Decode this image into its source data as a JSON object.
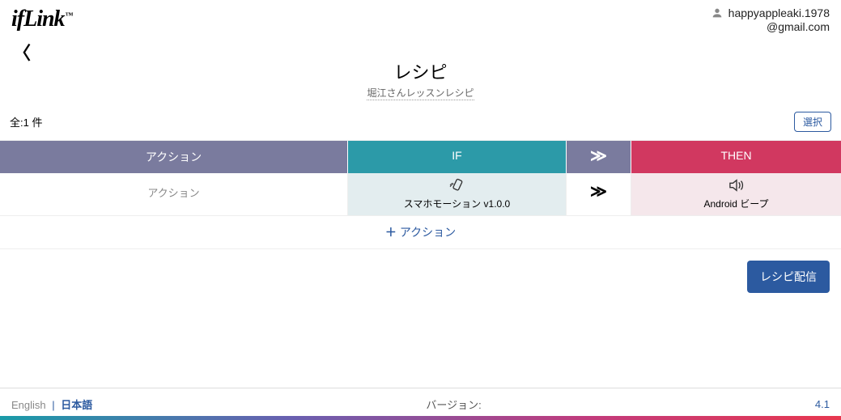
{
  "logo": {
    "text": "ifLink",
    "tm": "™"
  },
  "user": {
    "name": "happyappleaki.1978",
    "domain": "@gmail.com"
  },
  "page": {
    "title": "レシピ",
    "subtitle": "堀江さんレッスンレシピ"
  },
  "count": {
    "prefix": "全:1 件"
  },
  "buttons": {
    "select": "選択",
    "add_action": "アクション",
    "add_plus": "＋",
    "distribute": "レシピ配信"
  },
  "headers": {
    "action": "アクション",
    "if": "IF",
    "arrow": "≫",
    "then": "THEN"
  },
  "row": {
    "action": "アクション",
    "if": {
      "label": "スマホモーション v1.0.0"
    },
    "arrow": "≫",
    "then": {
      "label": "Android ビープ"
    }
  },
  "footer": {
    "lang_en": "English",
    "lang_sep": "|",
    "lang_jp": "日本語",
    "version_label": "バージョン:",
    "version_value": "4.1"
  }
}
